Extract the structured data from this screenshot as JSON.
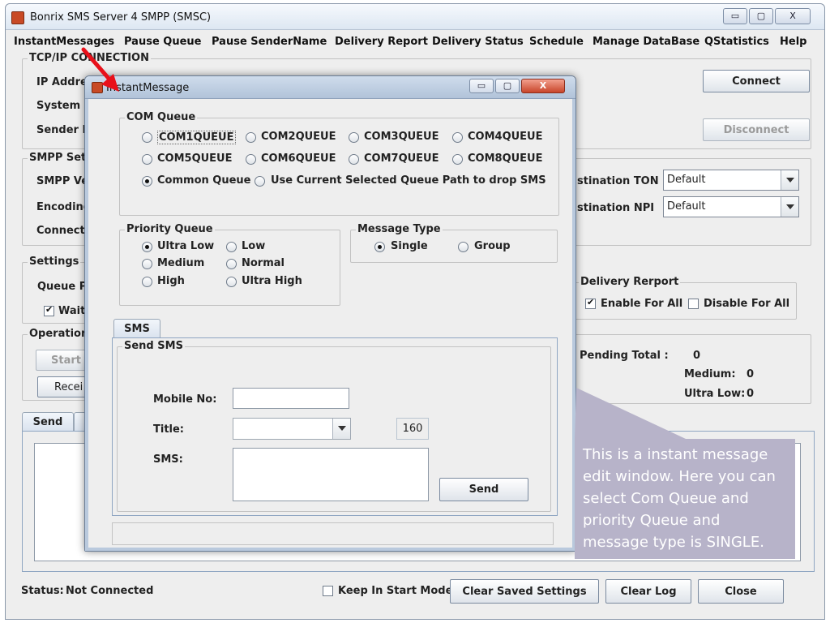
{
  "window": {
    "title": "Bonrix SMS Server 4 SMPP (SMSC)",
    "controls": {
      "minimize": "▭",
      "maximize": "▢",
      "close": "X"
    }
  },
  "menu": [
    "InstantMessages",
    "Pause Queue",
    "Pause SenderName",
    "Delivery Report",
    "Delivery Status",
    "Schedule",
    "Manage DataBase",
    "QStatistics",
    "Help"
  ],
  "tcp": {
    "title": "TCP/IP CONNECTION",
    "ip_label": "IP Addre",
    "system_label": "System I",
    "sender_label": "Sender N",
    "connect": "Connect",
    "disconnect": "Disconnect"
  },
  "smpp": {
    "title": "SMPP Set",
    "version_label": "SMPP Ve",
    "encoding_label": "Encoding",
    "connect_label": "Connect",
    "dest_ton_label": "stination TON",
    "dest_ton_value": "Default",
    "dest_npi_label": "stination NPI",
    "dest_npi_value": "Default"
  },
  "settings": {
    "title": "Settings",
    "queue_label": "Queue  P",
    "wait_label": "Wait"
  },
  "delivery": {
    "title": "Delivery Rerport",
    "enable": "Enable For All",
    "disable": "Disable For All"
  },
  "operation": {
    "title": "Operation",
    "start": "Start",
    "receive": "Recei"
  },
  "pending": {
    "total_label": "Pending Total :",
    "total_value": "0",
    "medium_label": "Medium:",
    "medium_value": "0",
    "ultralow_label": "Ultra Low:",
    "ultralow_value": "0"
  },
  "main_tabs": {
    "send": "Send",
    "second": "I"
  },
  "status": {
    "label": "Status:",
    "value": "Not Connected",
    "keep_start": "Keep In Start Mode",
    "clear_saved": "Clear Saved Settings",
    "clear_log": "Clear Log",
    "close": "Close"
  },
  "dialog": {
    "title": "InstantMessage",
    "com_queue": {
      "title": "COM Queue",
      "options": [
        "COM1QUEUE",
        "COM2QUEUE",
        "COM3QUEUE",
        "COM4QUEUE",
        "COM5QUEUE",
        "COM6QUEUE",
        "COM7QUEUE",
        "COM8QUEUE"
      ],
      "common": "Common Queue",
      "current_path": "Use Current Selected Queue Path to drop SMS",
      "selected": "Common Queue"
    },
    "priority": {
      "title": "Priority Queue",
      "options": [
        "Ultra Low",
        "Low",
        "Medium",
        "Normal",
        "High",
        "Ultra High"
      ],
      "selected": "Ultra Low"
    },
    "message_type": {
      "title": "Message Type",
      "options": [
        "Single",
        "Group"
      ],
      "selected": "Single"
    },
    "sms_tab": "SMS",
    "send_sms": {
      "title": "Send SMS",
      "mobile_label": "Mobile No:",
      "mobile_value": "",
      "title_label": "Title:",
      "title_value": "",
      "count": "160",
      "sms_label": "SMS:",
      "sms_value": "",
      "send": "Send"
    }
  },
  "annotation": {
    "text": "This is a instant message edit window. Here you can select Com Queue and priority Queue and message type is SINGLE.",
    "arrow_color": "#e8101a",
    "box_color": "#b7b3c9"
  }
}
